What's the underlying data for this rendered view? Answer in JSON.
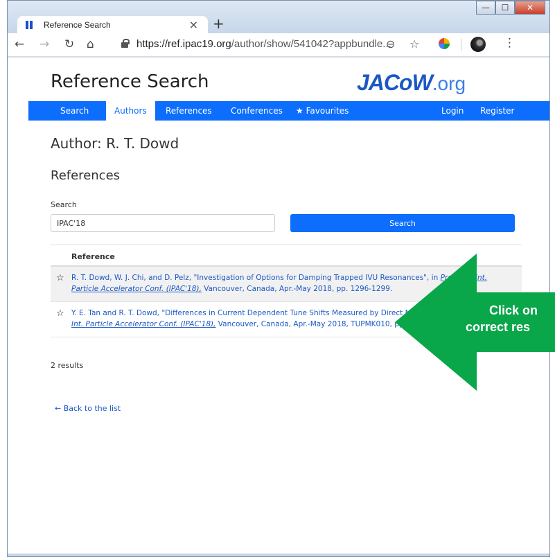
{
  "browser": {
    "tab_title": "Reference Search",
    "tab_close": "×",
    "new_tab": "+",
    "url_host": "https://ref.ipac19.org",
    "url_path": "/author/show/541042?appbundle...",
    "window_min": "—",
    "window_max": "☐",
    "window_close": "✕"
  },
  "site": {
    "title": "Reference Search",
    "logo_main": "JACoW",
    "logo_tld": ".org"
  },
  "nav": {
    "items": [
      "Search",
      "Authors",
      "References",
      "Conferences",
      "Favourites"
    ],
    "active": "Authors",
    "right_items": [
      "Login",
      "Register"
    ]
  },
  "main": {
    "heading": "Author: R. T. Dowd",
    "subheading": "References",
    "search_label": "Search",
    "search_value": "IPAC'18",
    "search_button": "Search",
    "column_header": "Reference",
    "references": [
      {
        "text_before": "R. T. Dowd, W. J. Chi, and D. Pelz, \"Investigation of Options for Damping Trapped IVU Resonances\", in ",
        "publication": "Proc. 9th Int. Particle Accelerator Conf. (IPAC'18),",
        "text_after": " Vancouver, Canada, Apr.-May 2018, pp. 1296-1299."
      },
      {
        "text_before": "Y. E. Tan and R. T. Dowd, \"Differences in Current Dependent Tune Shifts Measured by Direct Methods\", in ",
        "publication": "Proc. 9th Int. Particle Accelerator Conf. (IPAC'18),",
        "text_after": " Vancouver, Canada, Apr.-May 2018, TUPMK010, pp. 1510-1512."
      }
    ],
    "results_count": "2 results",
    "back_link": "← Back to the list"
  },
  "annotation": {
    "line1": "Click on",
    "line2": "correct res",
    "color": "#0aa64a"
  }
}
